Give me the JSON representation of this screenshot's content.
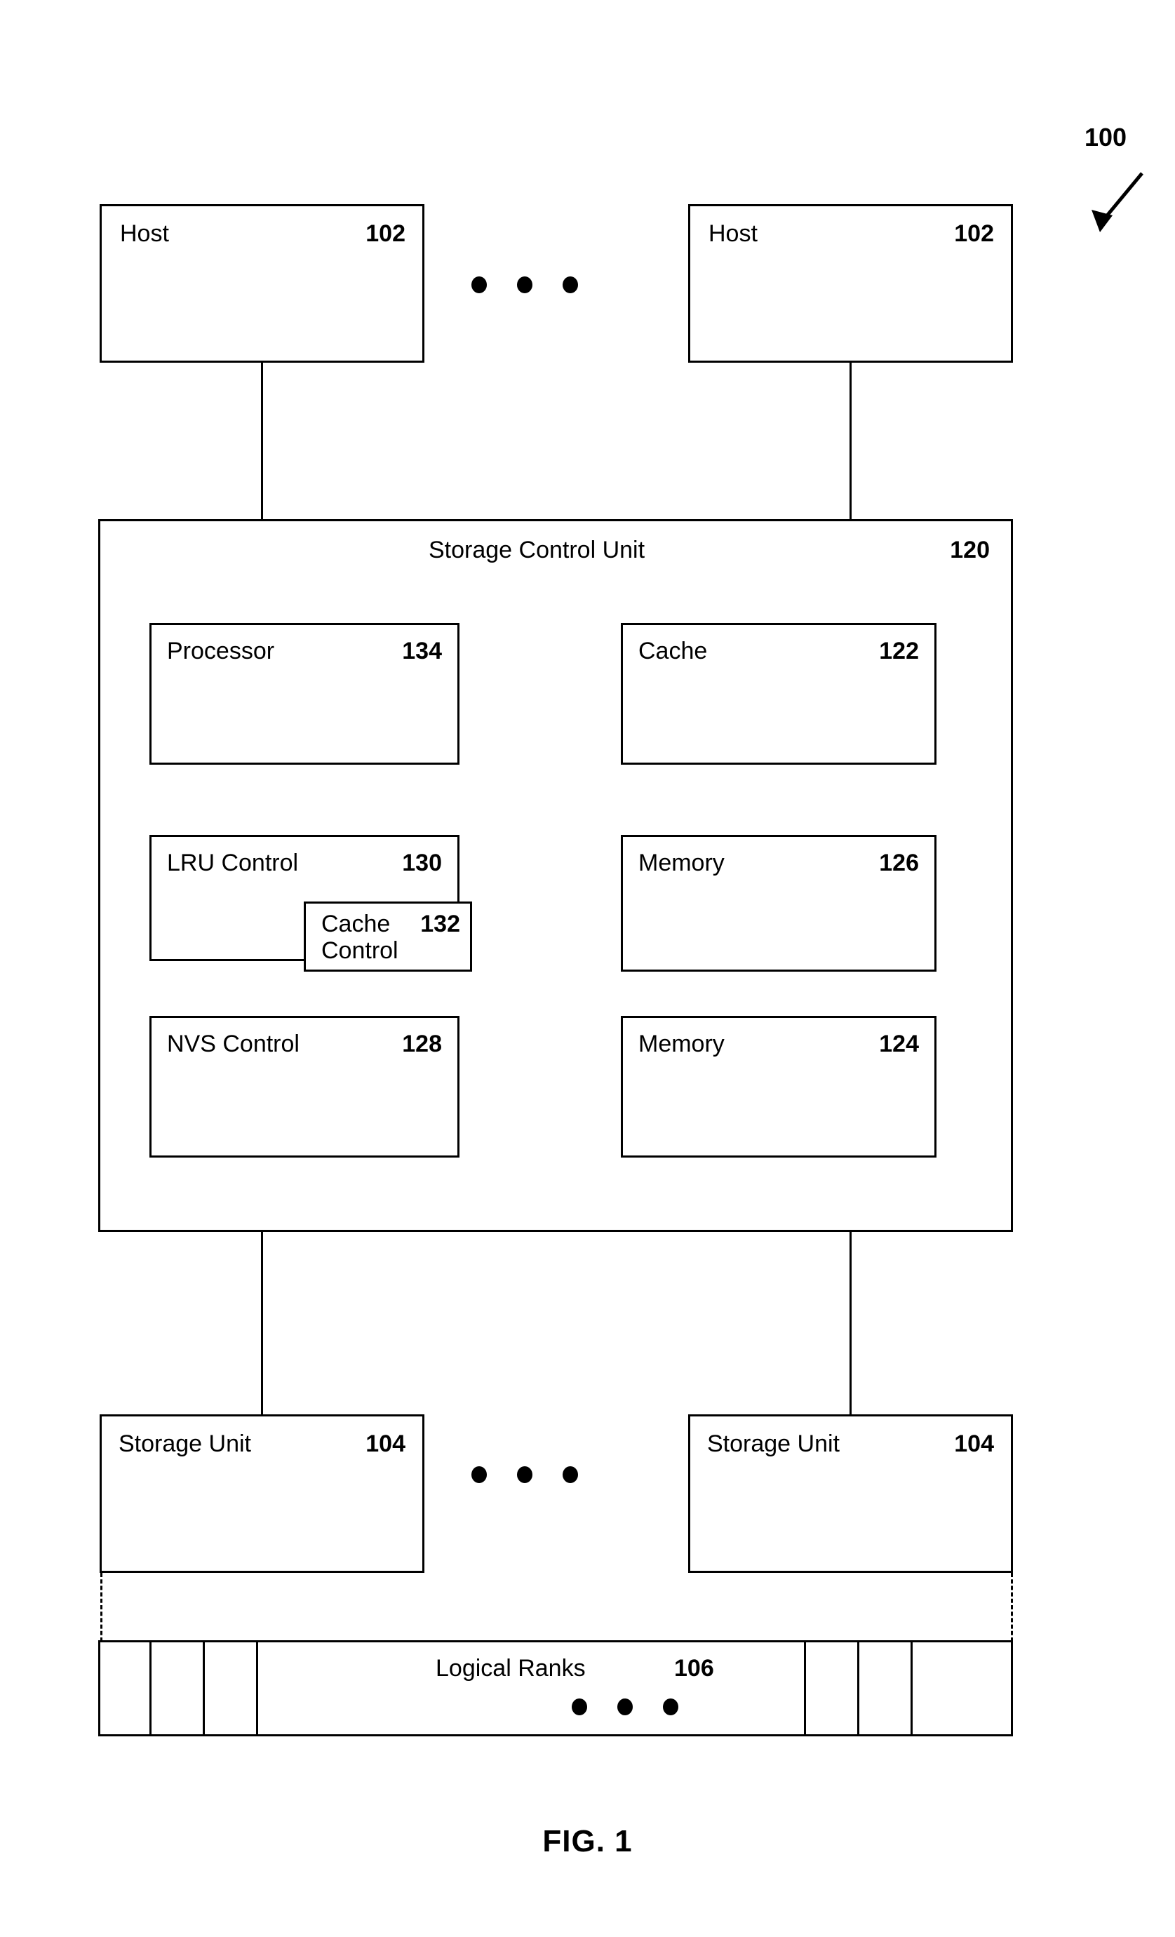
{
  "figure": {
    "caption": "FIG. 1",
    "system_ref": "100"
  },
  "hosts": [
    {
      "label": "Host",
      "ref": "102"
    },
    {
      "label": "Host",
      "ref": "102"
    }
  ],
  "host_ellipsis": "● ● ●",
  "storage_control_unit": {
    "label": "Storage Control Unit",
    "ref": "120",
    "components": [
      {
        "label": "Processor",
        "ref": "134"
      },
      {
        "label": "Cache",
        "ref": "122"
      },
      {
        "label": "LRU Control",
        "ref": "130"
      },
      {
        "label": "Memory",
        "ref": "126"
      },
      {
        "label": "Cache\nControl",
        "ref": "132"
      },
      {
        "label": "NVS Control",
        "ref": "128"
      },
      {
        "label": "Memory",
        "ref": "124"
      }
    ]
  },
  "storage_units": [
    {
      "label": "Storage Unit",
      "ref": "104"
    },
    {
      "label": "Storage Unit",
      "ref": "104"
    }
  ],
  "storage_unit_ellipsis": "● ● ●",
  "logical_ranks": {
    "label": "Logical Ranks",
    "ref": "106",
    "ellipsis": "● ● ●"
  },
  "colors": {
    "line": "#000000",
    "background": "#ffffff"
  }
}
